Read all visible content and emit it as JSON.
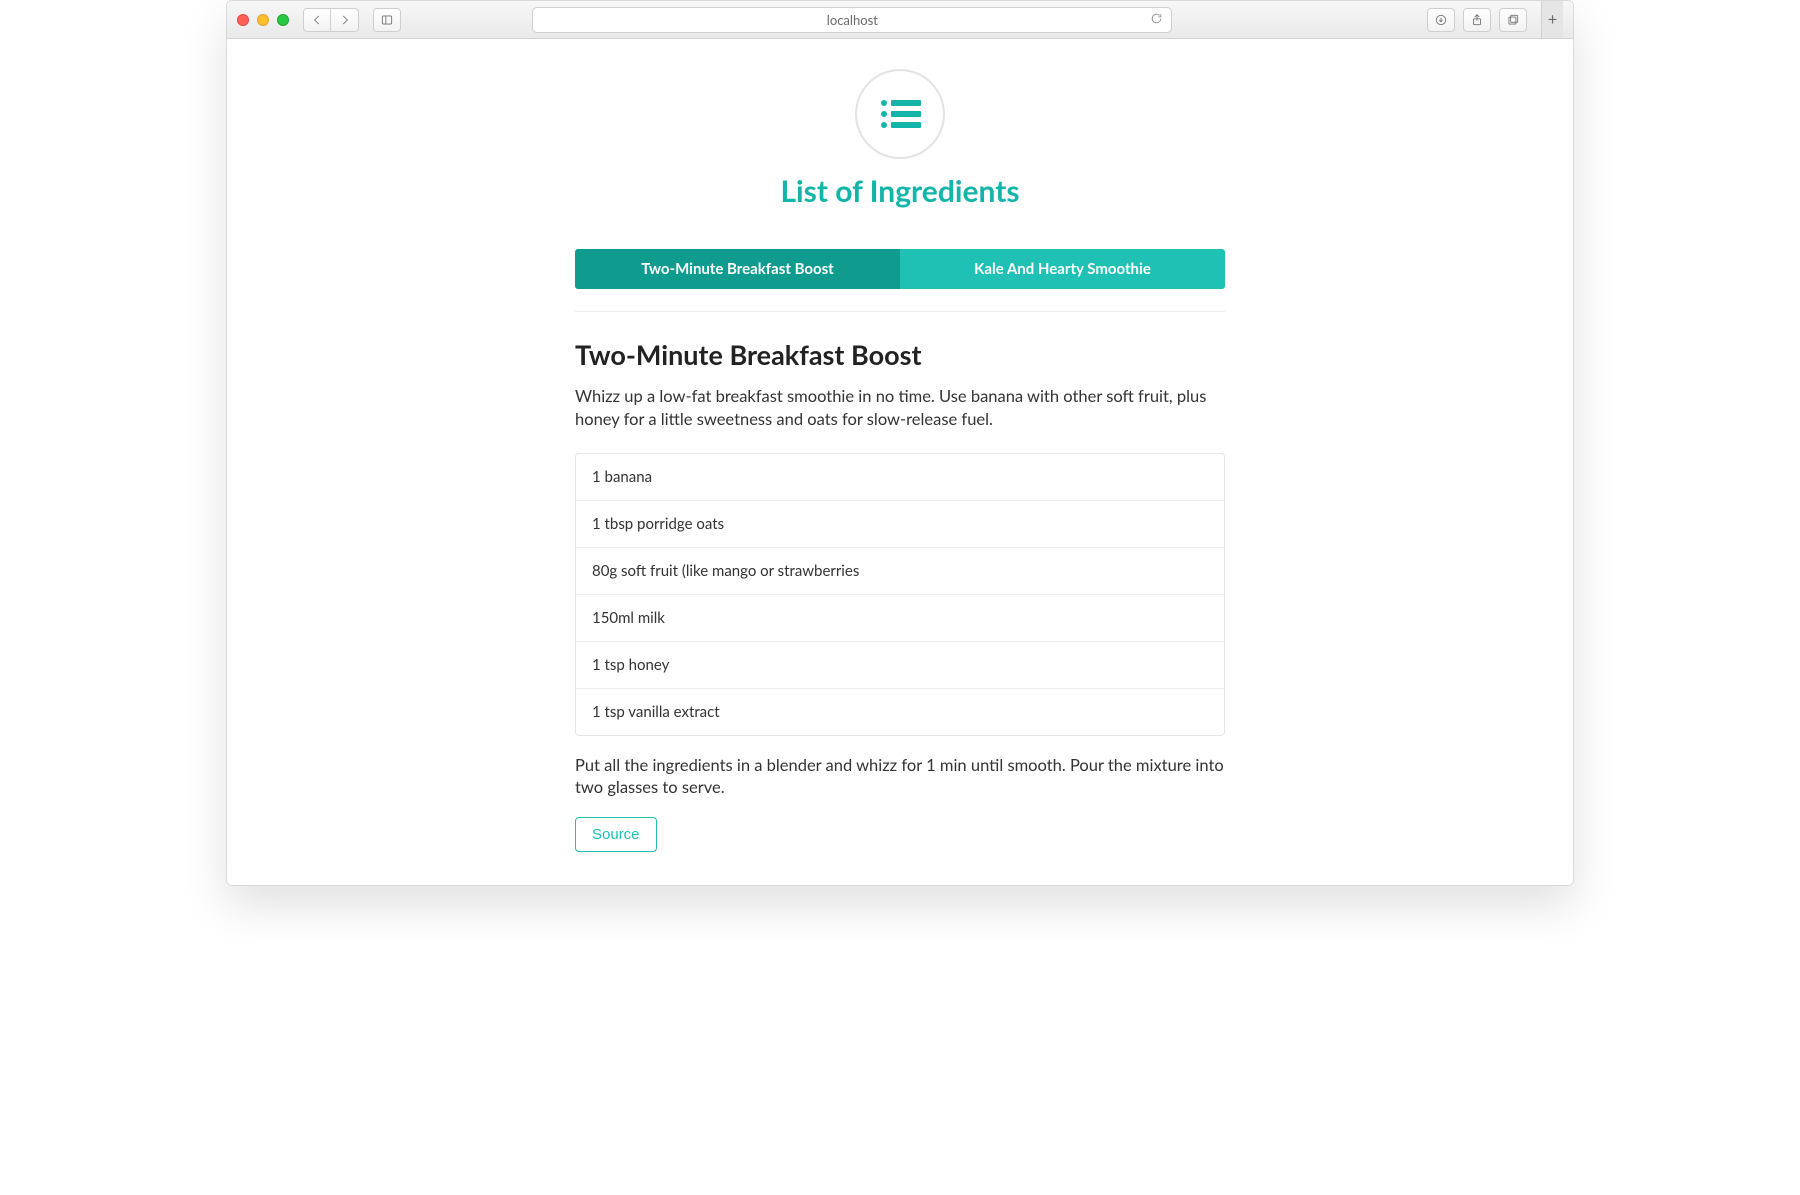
{
  "browser": {
    "address": "localhost"
  },
  "hero": {
    "title": "List of Ingredients"
  },
  "tabs": [
    {
      "label": "Two-Minute Breakfast Boost",
      "active": true
    },
    {
      "label": "Kale And Hearty Smoothie",
      "active": false
    }
  ],
  "recipe": {
    "title": "Two-Minute Breakfast Boost",
    "lede": "Whizz up a low-fat breakfast smoothie in no time. Use banana with other soft fruit, plus honey for a little sweetness and oats for slow-release fuel.",
    "ingredients": [
      "1 banana",
      "1 tbsp porridge oats",
      "80g soft fruit (like mango or strawberries",
      "150ml milk",
      "1 tsp honey",
      "1 tsp vanilla extract"
    ],
    "method": "Put all the ingredients in a blender and whizz for 1 min until smooth. Pour the mixture into two glasses to serve.",
    "source_label": "Source"
  }
}
